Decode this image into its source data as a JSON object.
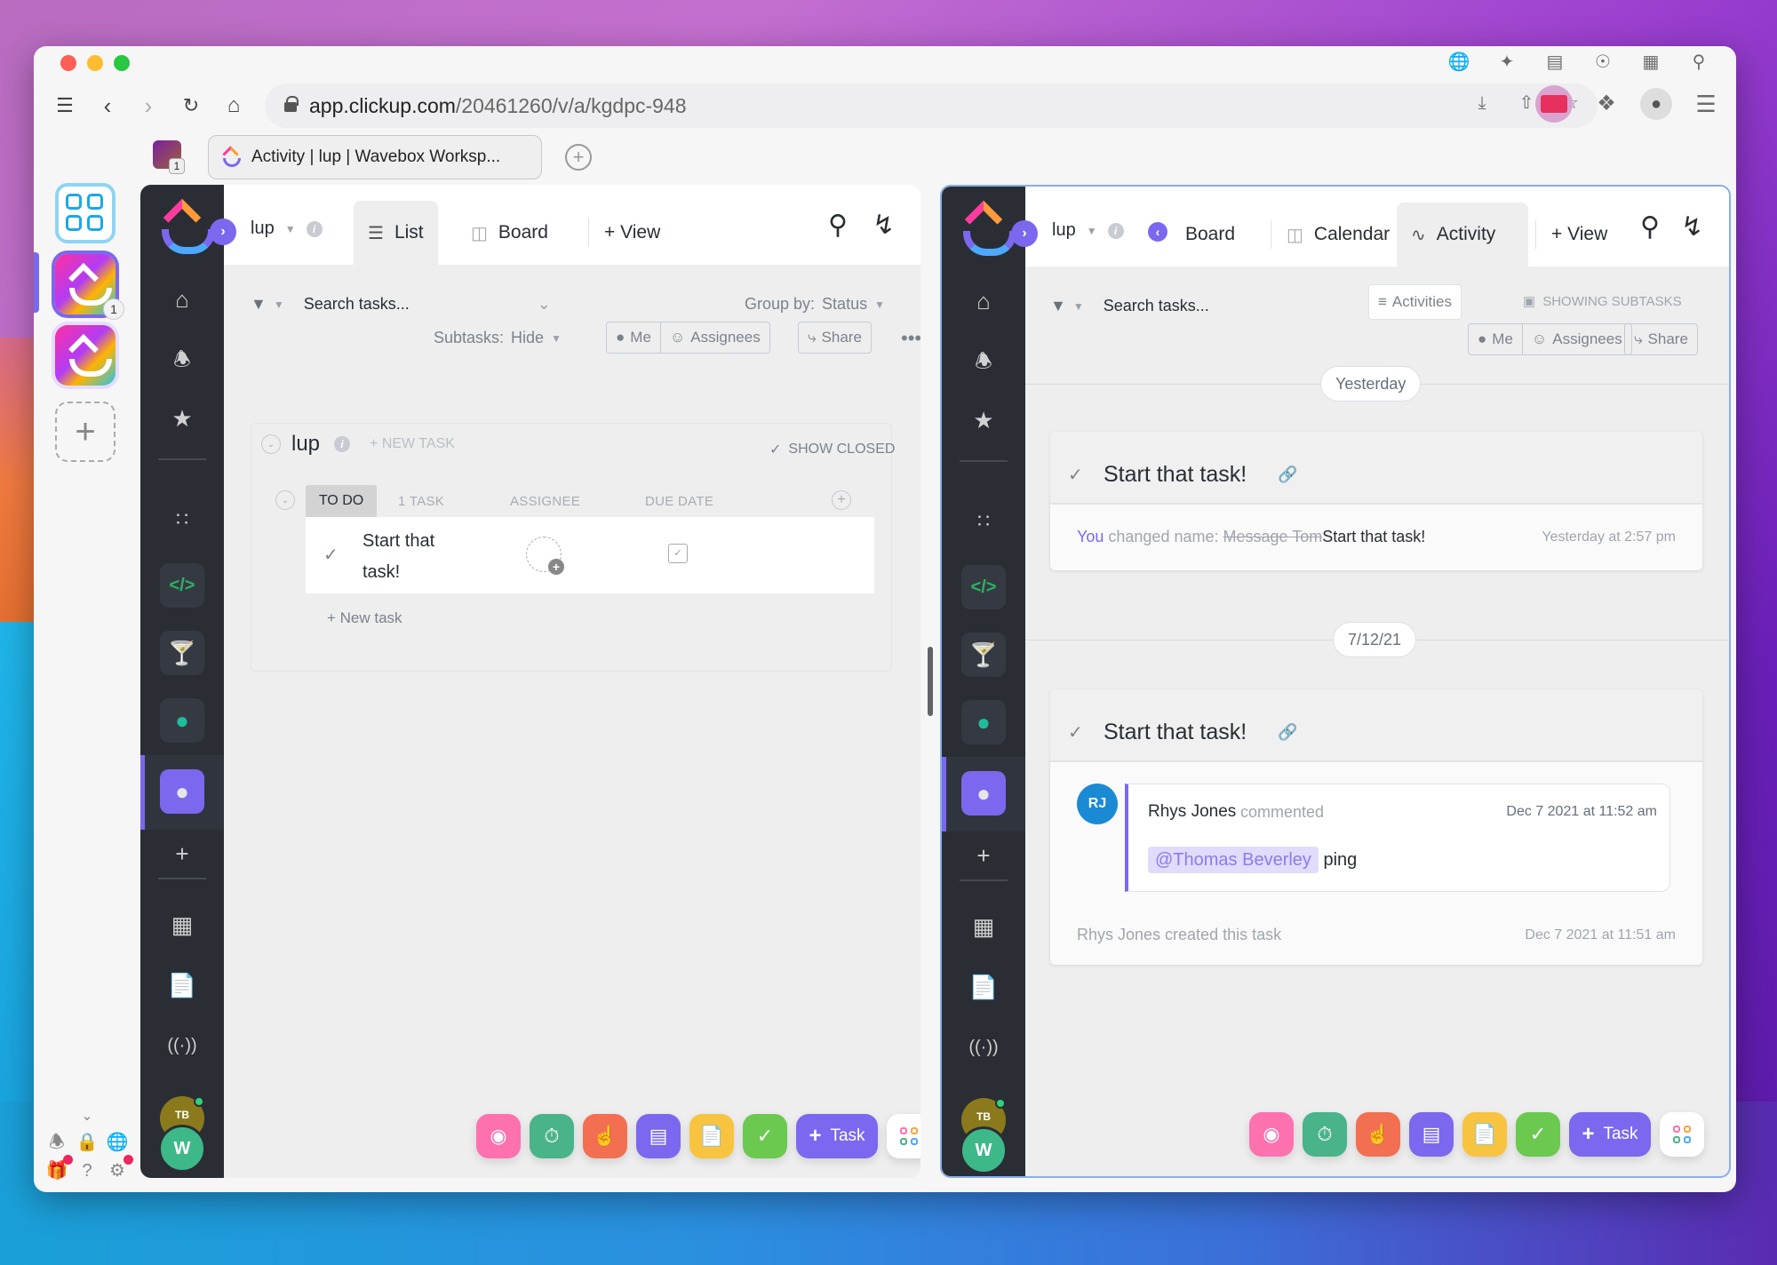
{
  "browser": {
    "url_host": "app.clickup.com",
    "url_path": "/20461260/v/a/kgdpc-948",
    "tab_title": "Activity | lup | Wavebox Worksp...",
    "workspace_badge": "1",
    "top_icons": [
      "globe-icon",
      "magic-wand-icon",
      "table-icon",
      "compass-icon",
      "grid-icon",
      "search-icon"
    ],
    "toolbar_icons": [
      "download-icon",
      "share-icon",
      "star-icon",
      "extension-ticket-icon",
      "puzzle-icon",
      "profile-icon",
      "menu-icon"
    ]
  },
  "rail": {
    "apps": [
      {
        "name": "dashboard",
        "badge": ""
      },
      {
        "name": "clickup",
        "badge": "1"
      },
      {
        "name": "clickup",
        "badge": ""
      }
    ],
    "bottom_icons": [
      "bell-icon",
      "lock-icon",
      "globe-icon",
      "gift-icon",
      "help-icon",
      "gear-icon"
    ]
  },
  "left_panel": {
    "breadcrumb": "lup",
    "views": [
      {
        "label": "List",
        "icon": "list-icon",
        "active": true
      },
      {
        "label": "Board",
        "icon": "board-icon",
        "active": false
      }
    ],
    "add_view": "+ View",
    "search_placeholder": "Search tasks...",
    "group_by_label": "Group by:",
    "group_by_value": "Status",
    "subtasks_label": "Subtasks:",
    "subtasks_value": "Hide",
    "me_label": "Me",
    "assignees_label": "Assignees",
    "share_label": "Share",
    "list_name": "lup",
    "new_task_label": "+ NEW TASK",
    "show_closed_label": "SHOW CLOSED",
    "group": {
      "status": "TO DO",
      "count": "1 TASK",
      "columns": [
        "ASSIGNEE",
        "DUE DATE"
      ],
      "tasks": [
        {
          "name": "Start that task!"
        }
      ],
      "add_task": "+ New task"
    }
  },
  "right_panel": {
    "breadcrumb": "lup",
    "views": [
      {
        "label": "Board",
        "icon": "board-icon",
        "active": false
      },
      {
        "label": "Calendar",
        "icon": "calendar-icon",
        "active": false
      },
      {
        "label": "Activity",
        "icon": "activity-icon",
        "active": true
      }
    ],
    "add_view": "+ View",
    "search_placeholder": "Search tasks...",
    "activities_label": "Activities",
    "showing_subtasks_label": "SHOWING SUBTASKS",
    "me_label": "Me",
    "assignees_label": "Assignees",
    "share_label": "Share",
    "sections": [
      {
        "date": "Yesterday",
        "task": "Start that task!",
        "actor": "You",
        "action": "changed name:",
        "old_name": "Message Tom",
        "new_name": "Start that task!",
        "time": "Yesterday at 2:57 pm"
      },
      {
        "date": "7/12/21",
        "task": "Start that task!",
        "comment": {
          "initials": "RJ",
          "author": "Rhys Jones",
          "verb": "commented",
          "time": "Dec 7 2021 at 11:52 am",
          "mention": "@Thomas Beverley",
          "text": "ping"
        },
        "created_text": "Rhys Jones created this task",
        "created_time": "Dec 7 2021 at 11:51 am"
      }
    ]
  },
  "sidebar": {
    "avatar_tb": "TB",
    "avatar_w": "W"
  },
  "tray": {
    "task_label": "Task",
    "colors": {
      "record": "#fd71af",
      "timer": "#49b38a",
      "reminder": "#f36f52",
      "notepad": "#7b68ee",
      "doc": "#f8c440",
      "calendar": "#6bc950",
      "task": "#7b68ee"
    }
  }
}
